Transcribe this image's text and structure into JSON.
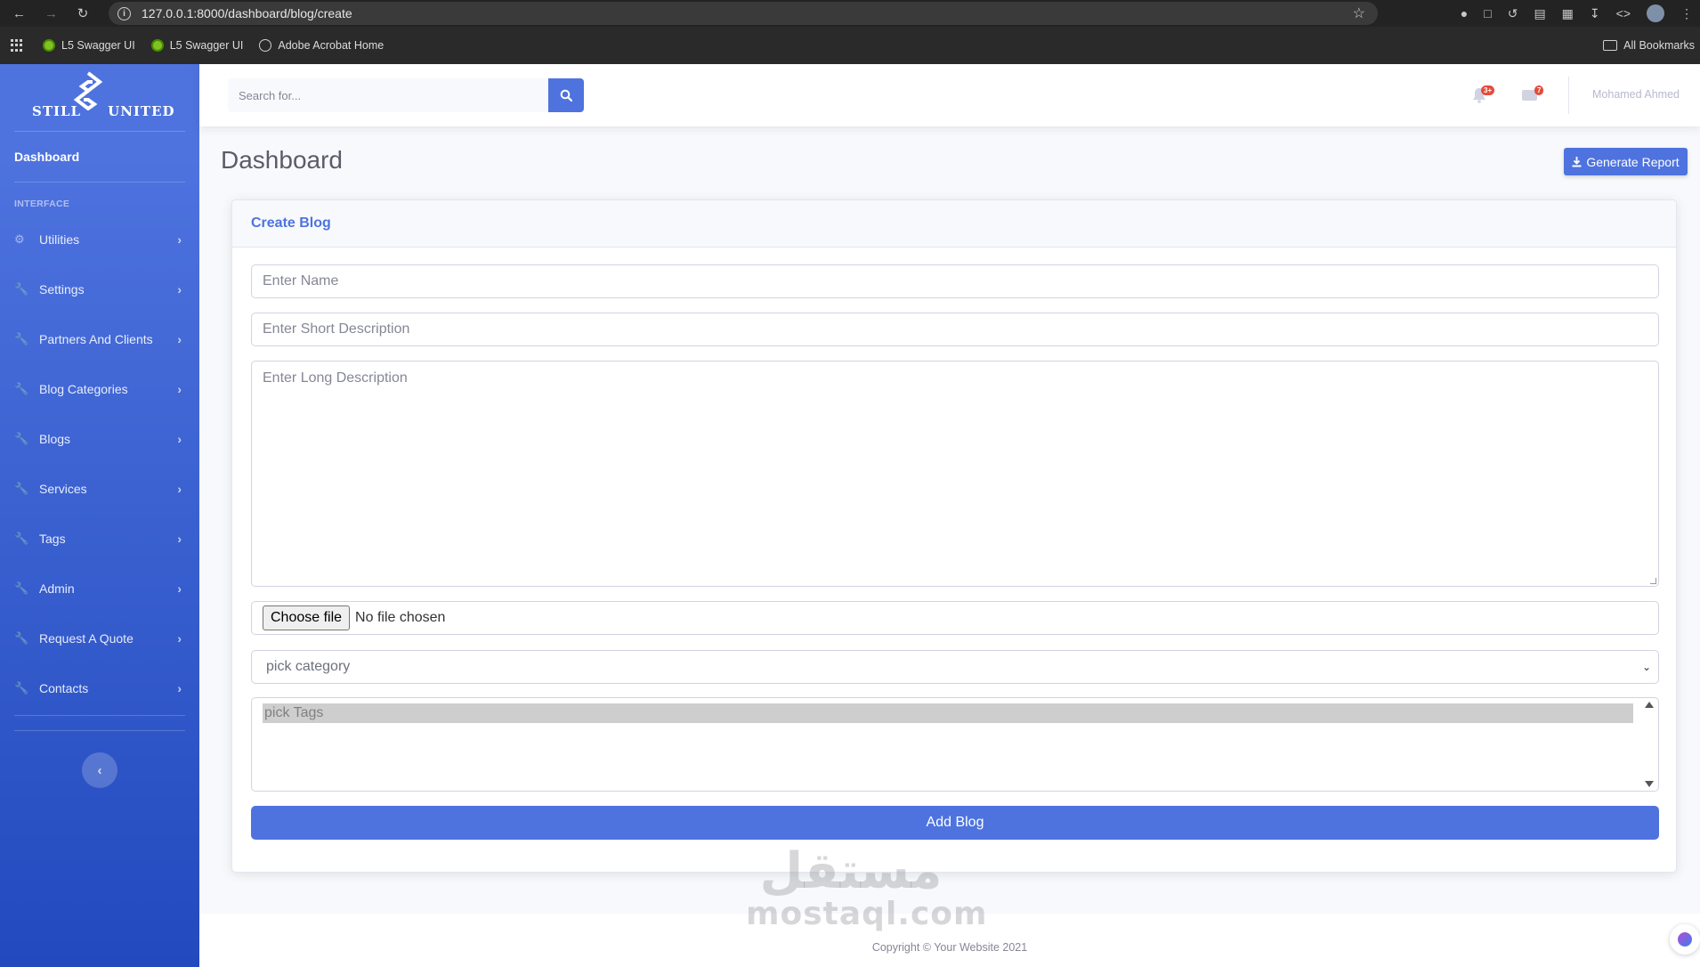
{
  "browser": {
    "url": "127.0.0.1:8000/dashboard/blog/create",
    "bookmarks": [
      {
        "label": "L5 Swagger UI",
        "icon": "swagger-icon"
      },
      {
        "label": "L5 Swagger UI",
        "icon": "swagger-icon"
      },
      {
        "label": "Adobe Acrobat Home",
        "icon": "globe-icon"
      }
    ],
    "all_bookmarks": "All Bookmarks"
  },
  "sidebar": {
    "brand": {
      "word1": "STILL",
      "word2": "UNITED"
    },
    "dashboard": "Dashboard",
    "heading": "INTERFACE",
    "items": [
      {
        "label": "Utilities",
        "icon": "cog-icon"
      },
      {
        "label": "Settings",
        "icon": "wrench-icon"
      },
      {
        "label": "Partners And Clients",
        "icon": "wrench-icon"
      },
      {
        "label": "Blog Categories",
        "icon": "wrench-icon"
      },
      {
        "label": "Blogs",
        "icon": "wrench-icon"
      },
      {
        "label": "Services",
        "icon": "wrench-icon"
      },
      {
        "label": "Tags",
        "icon": "wrench-icon"
      },
      {
        "label": "Admin",
        "icon": "wrench-icon"
      },
      {
        "label": "Request A Quote",
        "icon": "wrench-icon"
      },
      {
        "label": "Contacts",
        "icon": "wrench-icon"
      }
    ]
  },
  "topbar": {
    "search_placeholder": "Search for...",
    "alerts_badge": "3+",
    "messages_badge": "7",
    "user_name": "Mohamed Ahmed"
  },
  "page": {
    "title": "Dashboard",
    "report_button": "Generate Report"
  },
  "form": {
    "card_title": "Create Blog",
    "name_placeholder": "Enter Name",
    "short_desc_placeholder": "Enter Short Description",
    "long_desc_placeholder": "Enter Long Description",
    "file_button": "Choose file",
    "file_status": "No file chosen",
    "category_selected": "pick category",
    "tags_option": "pick Tags",
    "submit": "Add Blog"
  },
  "footer": {
    "copyright": "Copyright © Your Website 2021"
  },
  "watermark": {
    "arabic": "مستقل",
    "latin": "mostaql.com"
  },
  "colors": {
    "primary": "#4e73df",
    "sidebar_gradient_end": "#224abe",
    "badge": "#e74a3b"
  }
}
